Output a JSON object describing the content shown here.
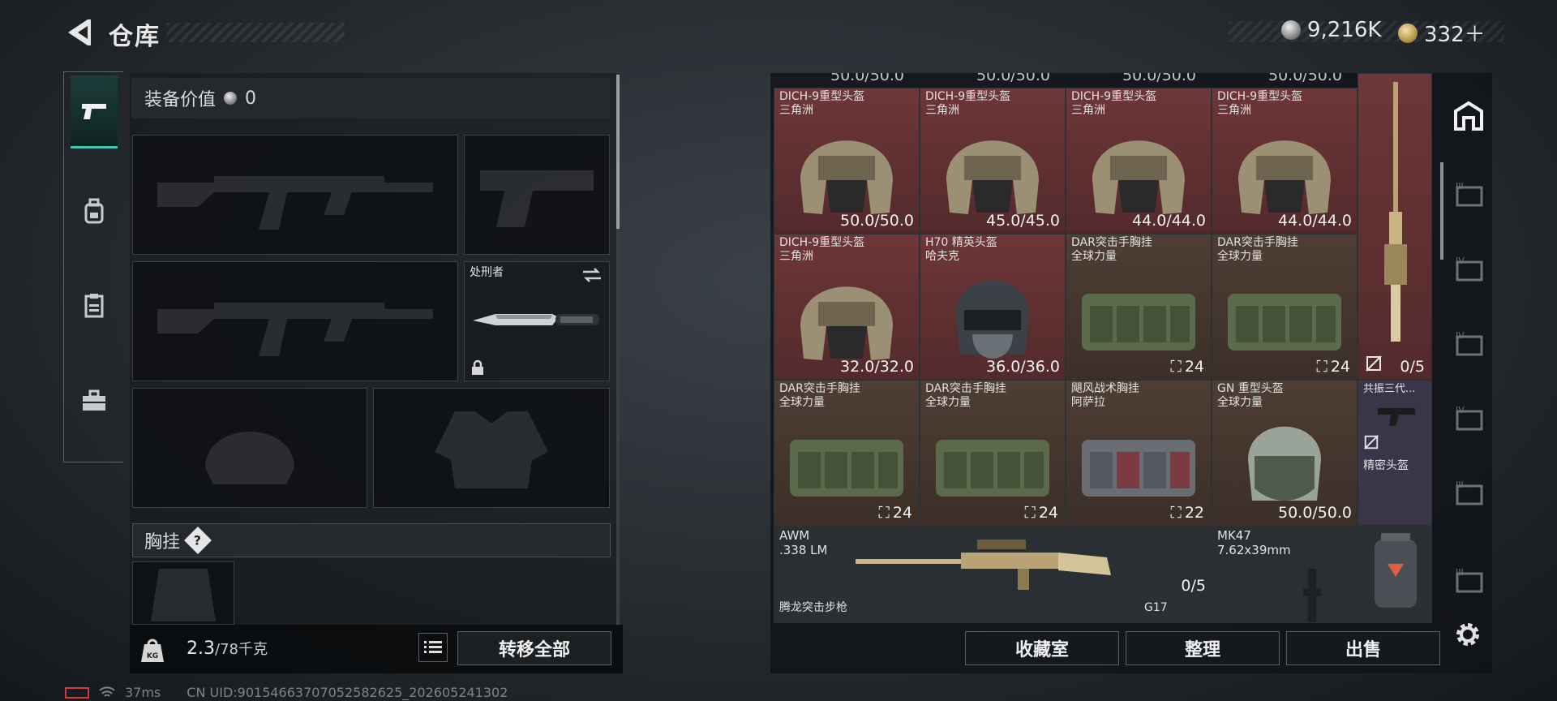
{
  "header": {
    "title": "仓库",
    "currency": [
      {
        "icon": "silver-coin-icon",
        "value": "9,216K"
      },
      {
        "icon": "gold-coin-icon",
        "value": "332＋"
      }
    ]
  },
  "nav": {
    "items": [
      {
        "icon": "pistol-icon",
        "active": true
      },
      {
        "icon": "backpack-icon",
        "active": false
      },
      {
        "icon": "clipboard-icon",
        "active": false
      },
      {
        "icon": "toolbox-icon",
        "active": false
      }
    ]
  },
  "equipment": {
    "value_label": "装备价值",
    "value": "0",
    "melee_slot": {
      "name": "处刑者"
    },
    "rig_label": "胸挂",
    "rig_help": "?",
    "weight_value": "2.3",
    "weight_max": "/78千克",
    "transfer_all": "转移全部"
  },
  "inventory": {
    "ghost_durability": "50.0/50.0",
    "cells": [
      {
        "name": "DICH-9重型头盔",
        "sub": "三角洲",
        "value": "50.0/50.0"
      },
      {
        "name": "DICH-9重型头盔",
        "sub": "三角洲",
        "value": "45.0/45.0"
      },
      {
        "name": "DICH-9重型头盔",
        "sub": "三角洲",
        "value": "44.0/44.0"
      },
      {
        "name": "DICH-9重型头盔",
        "sub": "三角洲",
        "value": "44.0/44.0"
      },
      {
        "name": "DICH-9重型头盔",
        "sub": "三角洲",
        "value": "32.0/32.0"
      },
      {
        "name": "H70 精英头盔",
        "sub": "哈夫克",
        "value": "36.0/36.0"
      },
      {
        "name": "DAR突击手胸挂",
        "sub": "全球力量",
        "qty": "24"
      },
      {
        "name": "DAR突击手胸挂",
        "sub": "全球力量",
        "qty": "24"
      },
      {
        "name": "DAR突击手胸挂",
        "sub": "全球力量",
        "qty": "24"
      },
      {
        "name": "DAR突击手胸挂",
        "sub": "全球力量",
        "qty": "24"
      },
      {
        "name": "飓风战术胸挂",
        "sub": "阿萨拉",
        "qty": "22"
      },
      {
        "name": "GN 重型头盔",
        "sub": "全球力量",
        "value": "50.0/50.0"
      }
    ],
    "sniper_tall": {
      "ammo": "0/5"
    },
    "resonance": {
      "name": "共振三代...",
      "sub": "精密头盔"
    },
    "awm": {
      "name": "AWM",
      "sub": ".338 LM",
      "ammo": "0/5"
    },
    "mk47": {
      "name": "MK47",
      "sub": "7.62x39mm"
    },
    "tenglong": {
      "name": "腾龙突击步枪"
    },
    "g17": {
      "name": "G17"
    }
  },
  "actions": {
    "collection": "收藏室",
    "sort": "整理",
    "sell": "出售"
  },
  "status": {
    "ping": "37ms",
    "uid": "CN UID:9015466370705258262­5_202605241302"
  },
  "colors": {
    "accent": "#3fc7b4",
    "red_rarity": "#6e3638",
    "brown_rarity": "#4e3e34"
  }
}
